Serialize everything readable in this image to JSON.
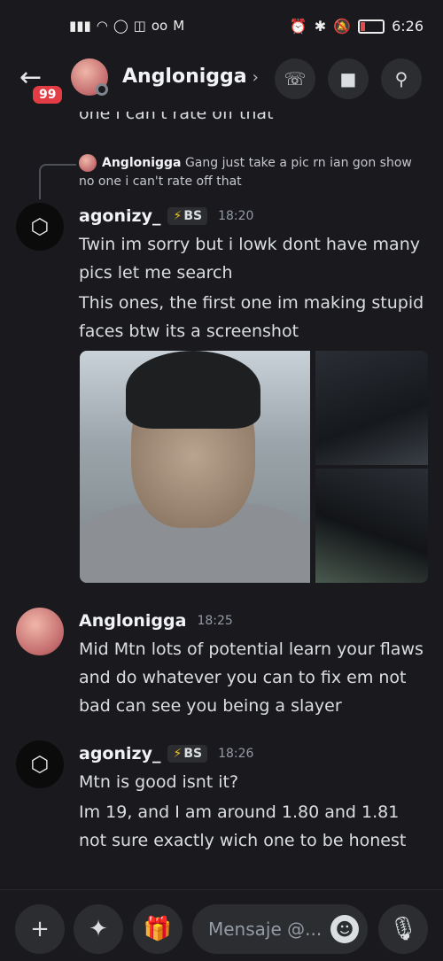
{
  "status": {
    "time": "6:26"
  },
  "header": {
    "unread_badge": "99",
    "title": "Anglonigga",
    "chevron": "›"
  },
  "messages": {
    "cut_text": "one i can't rate off that",
    "reply": {
      "author": "Anglonigga",
      "text": "Gang just take a pic rn ian gon show no one i can't rate off that"
    },
    "group1": {
      "author": "agonizy_",
      "tag": "BS",
      "time": "18:20",
      "lines": [
        "Twin im sorry but i lowk dont have many pics let me search",
        "This ones, the first one im making stupid faces btw its a screenshot"
      ]
    },
    "group2": {
      "author": "Anglonigga",
      "time": "18:25",
      "lines": [
        "Mid Mtn lots of potential learn your flaws and do whatever you can to fix em not bad can see you being a slayer"
      ]
    },
    "group3": {
      "author": "agonizy_",
      "tag": "BS",
      "time": "18:26",
      "lines": [
        "Mtn is good isnt it?",
        "Im 19, and I am around 1.80 and 1.81 not sure exactly wich one to be honest"
      ]
    }
  },
  "composer": {
    "placeholder": "Mensaje @..."
  }
}
